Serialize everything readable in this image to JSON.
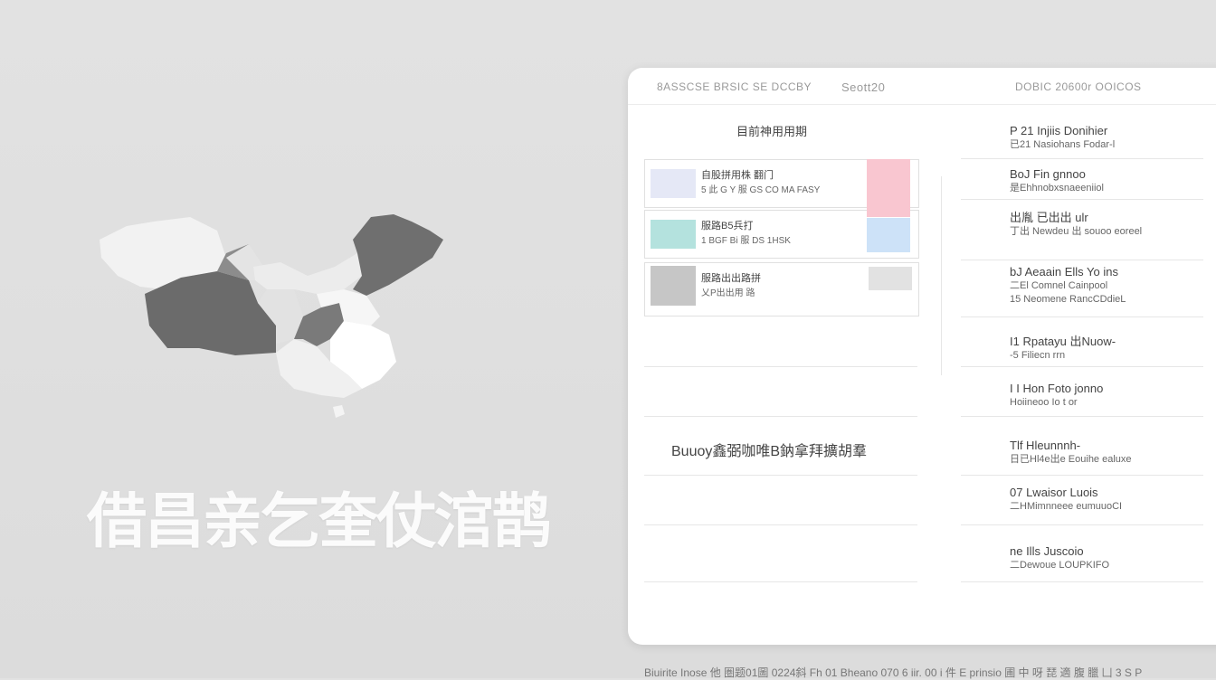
{
  "slogan": "借昌亲乞奎仗涫鹊",
  "panel": {
    "header": {
      "col1": "8ASSCSE BRSIC SE DCCBY",
      "col2": "Seott20",
      "col3": "DOBIC 20600r OOICOS"
    },
    "left": {
      "title": "目前神用用期",
      "rows": [
        {
          "line1": "自股拼用株 翻门",
          "line2": "5 此 G Y 服 GS CO MA FASY",
          "left_color": "#e5e8f6",
          "right_color": "#f9c6d0"
        },
        {
          "line1": "服路B5兵打",
          "line2": "1 BGF Bi 服 DS 1HSK",
          "left_color": "#b4e2de",
          "right_color": "#cde2f8"
        },
        {
          "line1": "服路出出路拼",
          "line2": "乂P出出用 路",
          "left_color": "#c6c6c6",
          "right_color": "#e2e2e2"
        }
      ],
      "caption": "Buuoy鑫弼咖唯B鈉拿拜擴胡羣"
    },
    "right": {
      "items": [
        {
          "name": "P 21 Injiis Donihier",
          "desc": "已21 Nasiohans Fodar-l"
        },
        {
          "name": "BoJ Fin gnnoo",
          "desc": "是Ehhnobxsnaeeniiol"
        },
        {
          "name": "出胤 已出出 ulr",
          "desc": "丁出 Newdeu 出 souoo eoreel"
        },
        {
          "name": "bJ Aeaain Ells Yo ins",
          "desc": "二El Comnel Cainpool"
        },
        {
          "name": "15 Neomene RancCDdieL",
          "desc": ""
        },
        {
          "name": "I1 Rpatayu 出Nuow-",
          "desc": "-5 Filiecn  rrn"
        },
        {
          "name": "I I Hon Foto jonno",
          "desc": "Hoiineoo Io t or"
        },
        {
          "name": "Tlf Hleunnnh-",
          "desc": "日已Hl4e出e Eouihe ealuxe"
        },
        {
          "name": "07 Lwaisor Luois",
          "desc": "二HMimnneee eumuuoCI"
        },
        {
          "name": "ne Ills Juscoio",
          "desc": "二Dewoue LOUPKIFO"
        }
      ]
    }
  },
  "footer": "Biuirite Inose 他 圏题01圖 0224斜 Fh 01 Bheano 070 6 iir.  00 i 件 E prinsio 圃 中 呀 琵 適 腹 臘 凵 3 S P"
}
